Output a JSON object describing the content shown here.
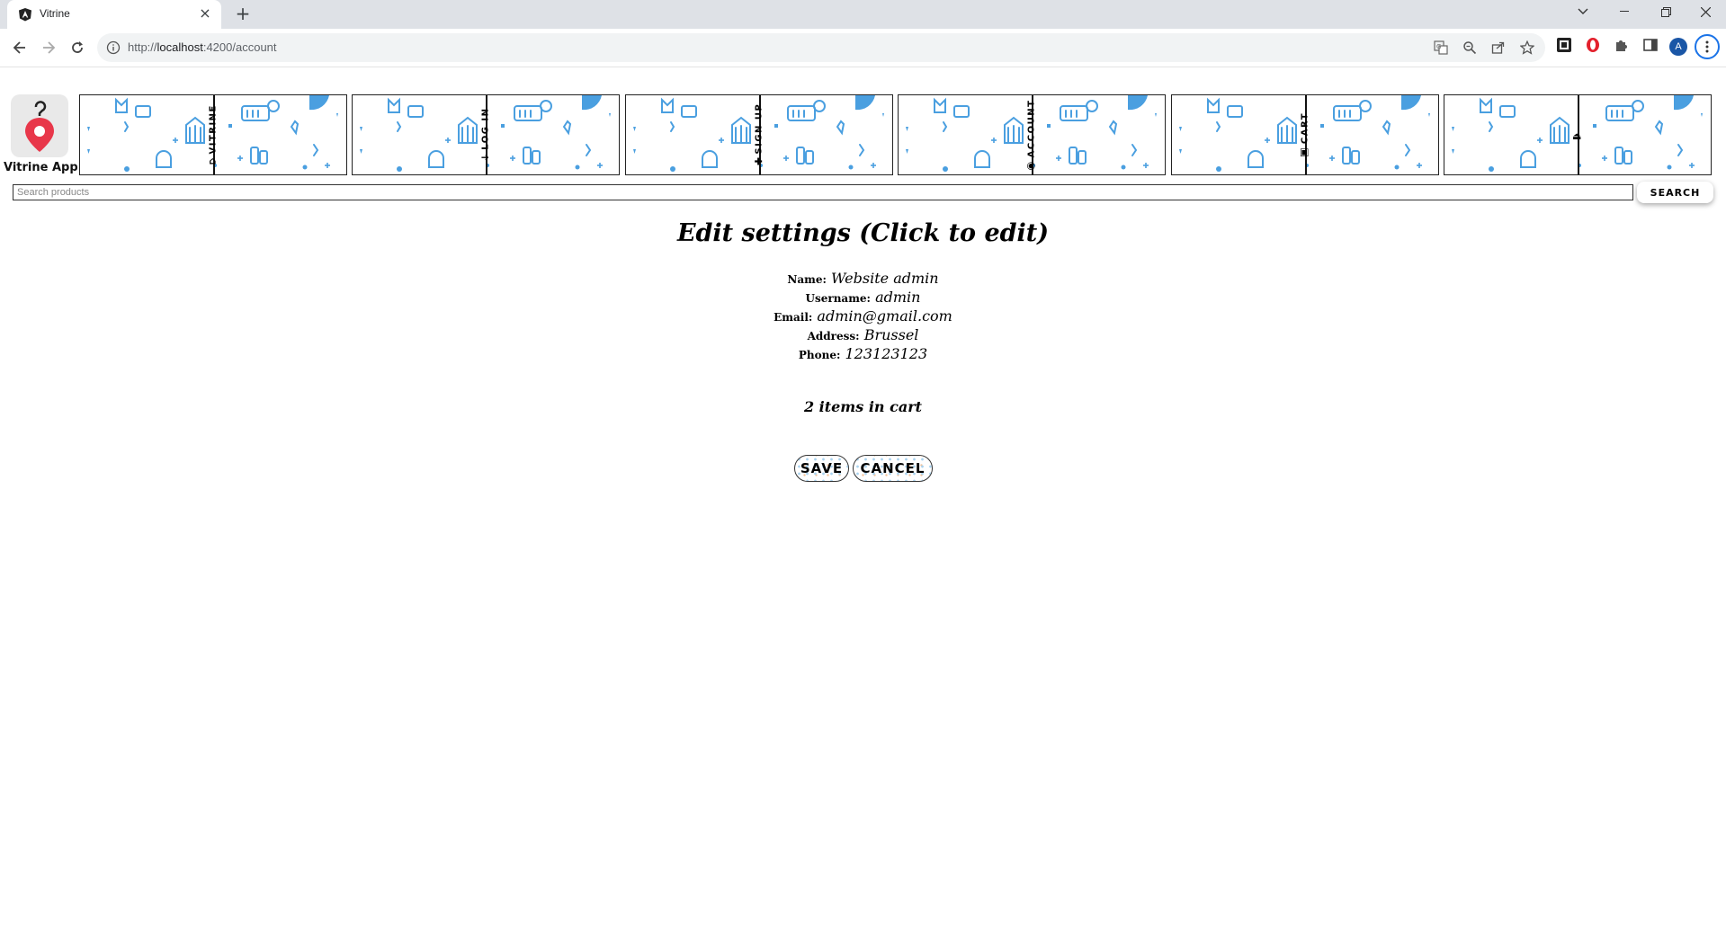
{
  "browser": {
    "tab_title": "Vitrine",
    "url_scheme": "http://",
    "url_host": "localhost",
    "url_rest": ":4200/account",
    "profile_initial": "A",
    "icons": [
      "angular-favicon",
      "translate-icon",
      "zoom-icon",
      "share-icon",
      "bookmark-star-icon",
      "extension-icon",
      "opera-icon",
      "puzzle-icon",
      "side-panel-icon",
      "kebab-menu-icon"
    ]
  },
  "header": {
    "logo_label": "Vitrine App",
    "nav": [
      {
        "label": "VITRINE",
        "icon": "home-icon"
      },
      {
        "label": "LOG IN",
        "icon": "login-icon"
      },
      {
        "label": "SIGN UP",
        "icon": "add-user-icon"
      },
      {
        "label": "ACCOUNT",
        "icon": "user-circle-icon"
      },
      {
        "label": "CART",
        "icon": "cart-icon"
      },
      {
        "label": "",
        "icon": "logout-icon"
      }
    ],
    "search_placeholder": "Search products",
    "search_button": "SEARCH"
  },
  "main": {
    "title": "Edit settings (Click to edit)",
    "fields": [
      {
        "label": "Name:",
        "value": "Website admin"
      },
      {
        "label": "Username:",
        "value": "admin"
      },
      {
        "label": "Email:",
        "value": "admin@gmail.com"
      },
      {
        "label": "Address:",
        "value": "Brussel"
      },
      {
        "label": "Phone:",
        "value": "123123123"
      }
    ],
    "cart_text": "2 items in cart",
    "save_label": "SAVE",
    "cancel_label": "CANCEL"
  },
  "colors": {
    "pattern_blue": "#4a9fe0",
    "accent_blue": "#1a73e8",
    "logo_red": "#e8374a"
  }
}
